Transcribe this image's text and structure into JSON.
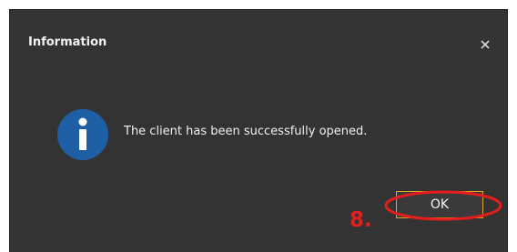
{
  "dialog": {
    "title": "Information",
    "close_icon": "close-icon",
    "message_icon": "info-icon",
    "message": "The client has been successfully opened.",
    "ok_label": "OK"
  },
  "annotation": {
    "step_label": "8.",
    "highlight_shape": "ellipse",
    "color": "#e51d1d"
  },
  "colors": {
    "dialog_background": "#333333",
    "info_icon_fill": "#1f5fa6",
    "button_border": "#e2a12a"
  }
}
